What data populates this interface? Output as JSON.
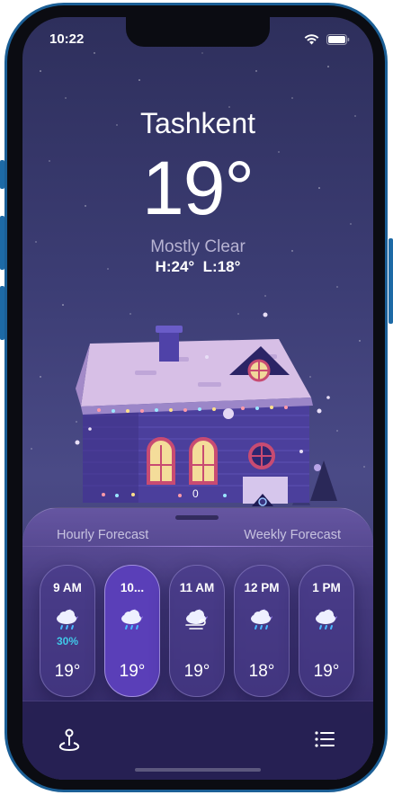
{
  "status": {
    "time": "10:22"
  },
  "location": {
    "city": "Tashkent",
    "temperature": "19°",
    "condition": "Mostly Clear",
    "high_low": "H:24°  L:18°"
  },
  "scene": {
    "counter": "0"
  },
  "forecast": {
    "tabs": {
      "hourly": "Hourly Forecast",
      "weekly": "Weekly Forecast"
    },
    "hours": [
      {
        "time": "9 AM",
        "icon": "cloud-moon-rain-icon",
        "precip": "30%",
        "temp": "19°"
      },
      {
        "time": "10...",
        "icon": "cloud-moon-rain-icon",
        "precip": "",
        "temp": "19°"
      },
      {
        "time": "11 AM",
        "icon": "cloud-moon-wind-icon",
        "precip": "",
        "temp": "19°"
      },
      {
        "time": "12 PM",
        "icon": "cloud-moon-rain-icon",
        "precip": "",
        "temp": "18°"
      },
      {
        "time": "1 PM",
        "icon": "cloud-moon-rain-icon",
        "precip": "",
        "temp": "19°"
      }
    ]
  },
  "toolbar": {
    "map_icon": "map-pin-icon",
    "list_icon": "list-icon"
  },
  "colors": {
    "accent": "#5a3fb8",
    "precip": "#40c8e8",
    "frame": "#1b5f96"
  }
}
